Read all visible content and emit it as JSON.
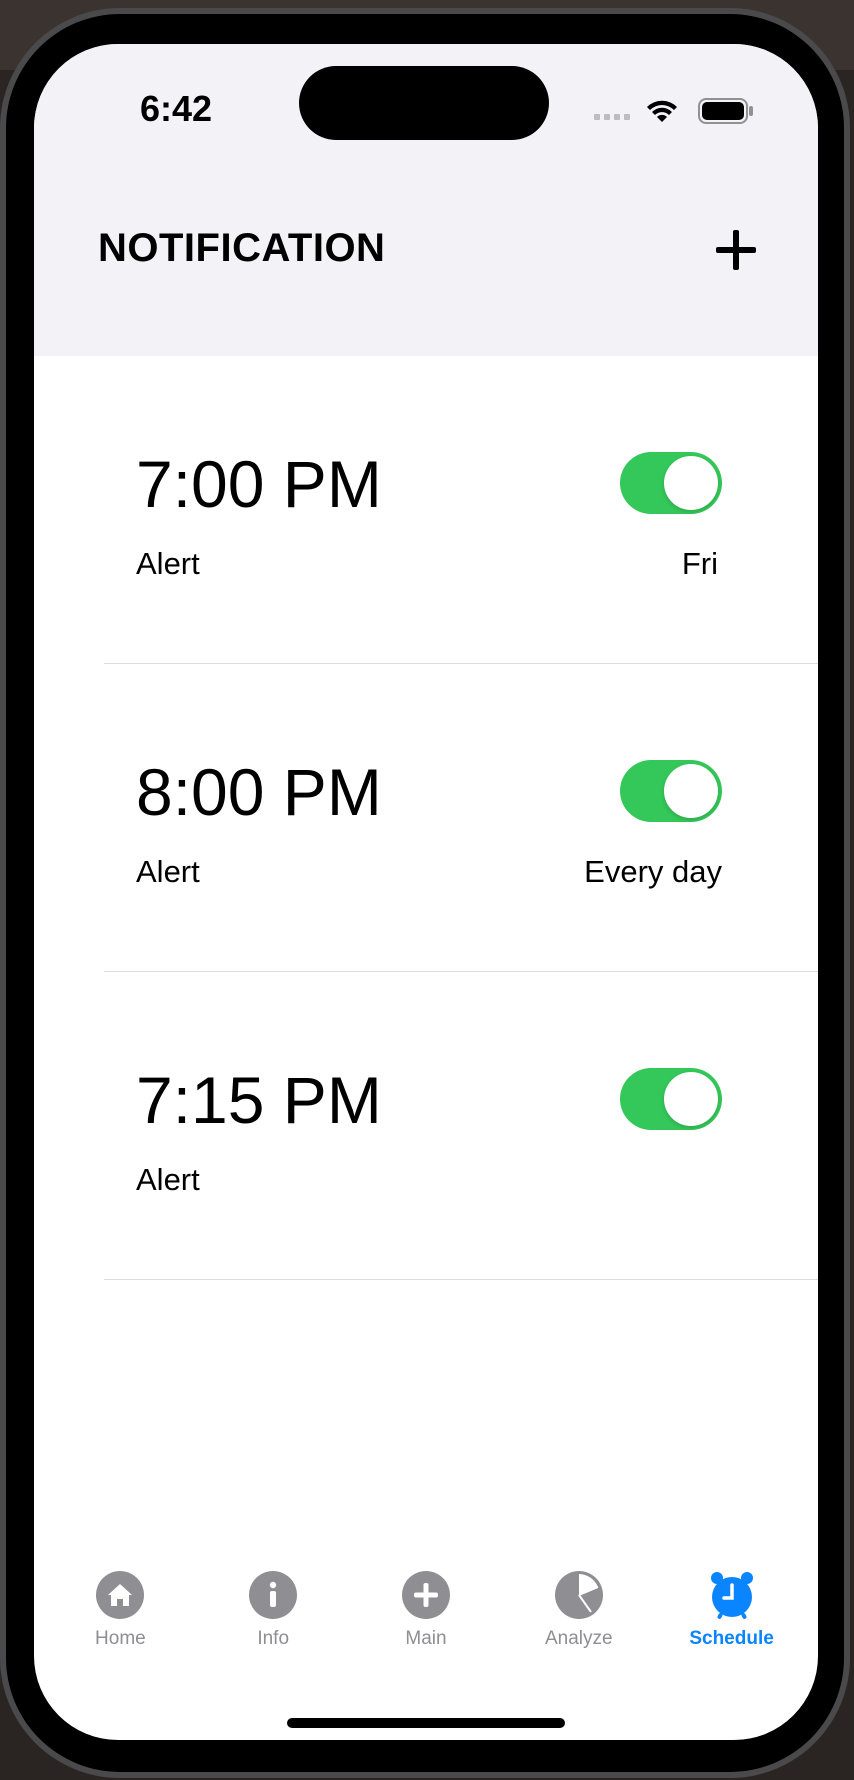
{
  "status_bar": {
    "time": "6:42"
  },
  "header": {
    "title": "NOTIFICATION"
  },
  "alarms": [
    {
      "time": "7:00 PM",
      "label": "Alert",
      "repeat": "Fri",
      "enabled": true
    },
    {
      "time": "8:00 PM",
      "label": "Alert",
      "repeat": "Every day",
      "enabled": true
    },
    {
      "time": "7:15 PM",
      "label": "Alert",
      "repeat": "",
      "enabled": true
    }
  ],
  "tabs": [
    {
      "label": "Home",
      "icon": "home-icon",
      "active": false
    },
    {
      "label": "Info",
      "icon": "info-icon",
      "active": false
    },
    {
      "label": "Main",
      "icon": "plus-circle-icon",
      "active": false
    },
    {
      "label": "Analyze",
      "icon": "pie-chart-icon",
      "active": false
    },
    {
      "label": "Schedule",
      "icon": "alarm-clock-icon",
      "active": true
    }
  ],
  "colors": {
    "accent": "#0a84ff",
    "toggle_on": "#34c759",
    "inactive_tab": "#8e8e93",
    "header_bg": "#f2f2f7"
  }
}
